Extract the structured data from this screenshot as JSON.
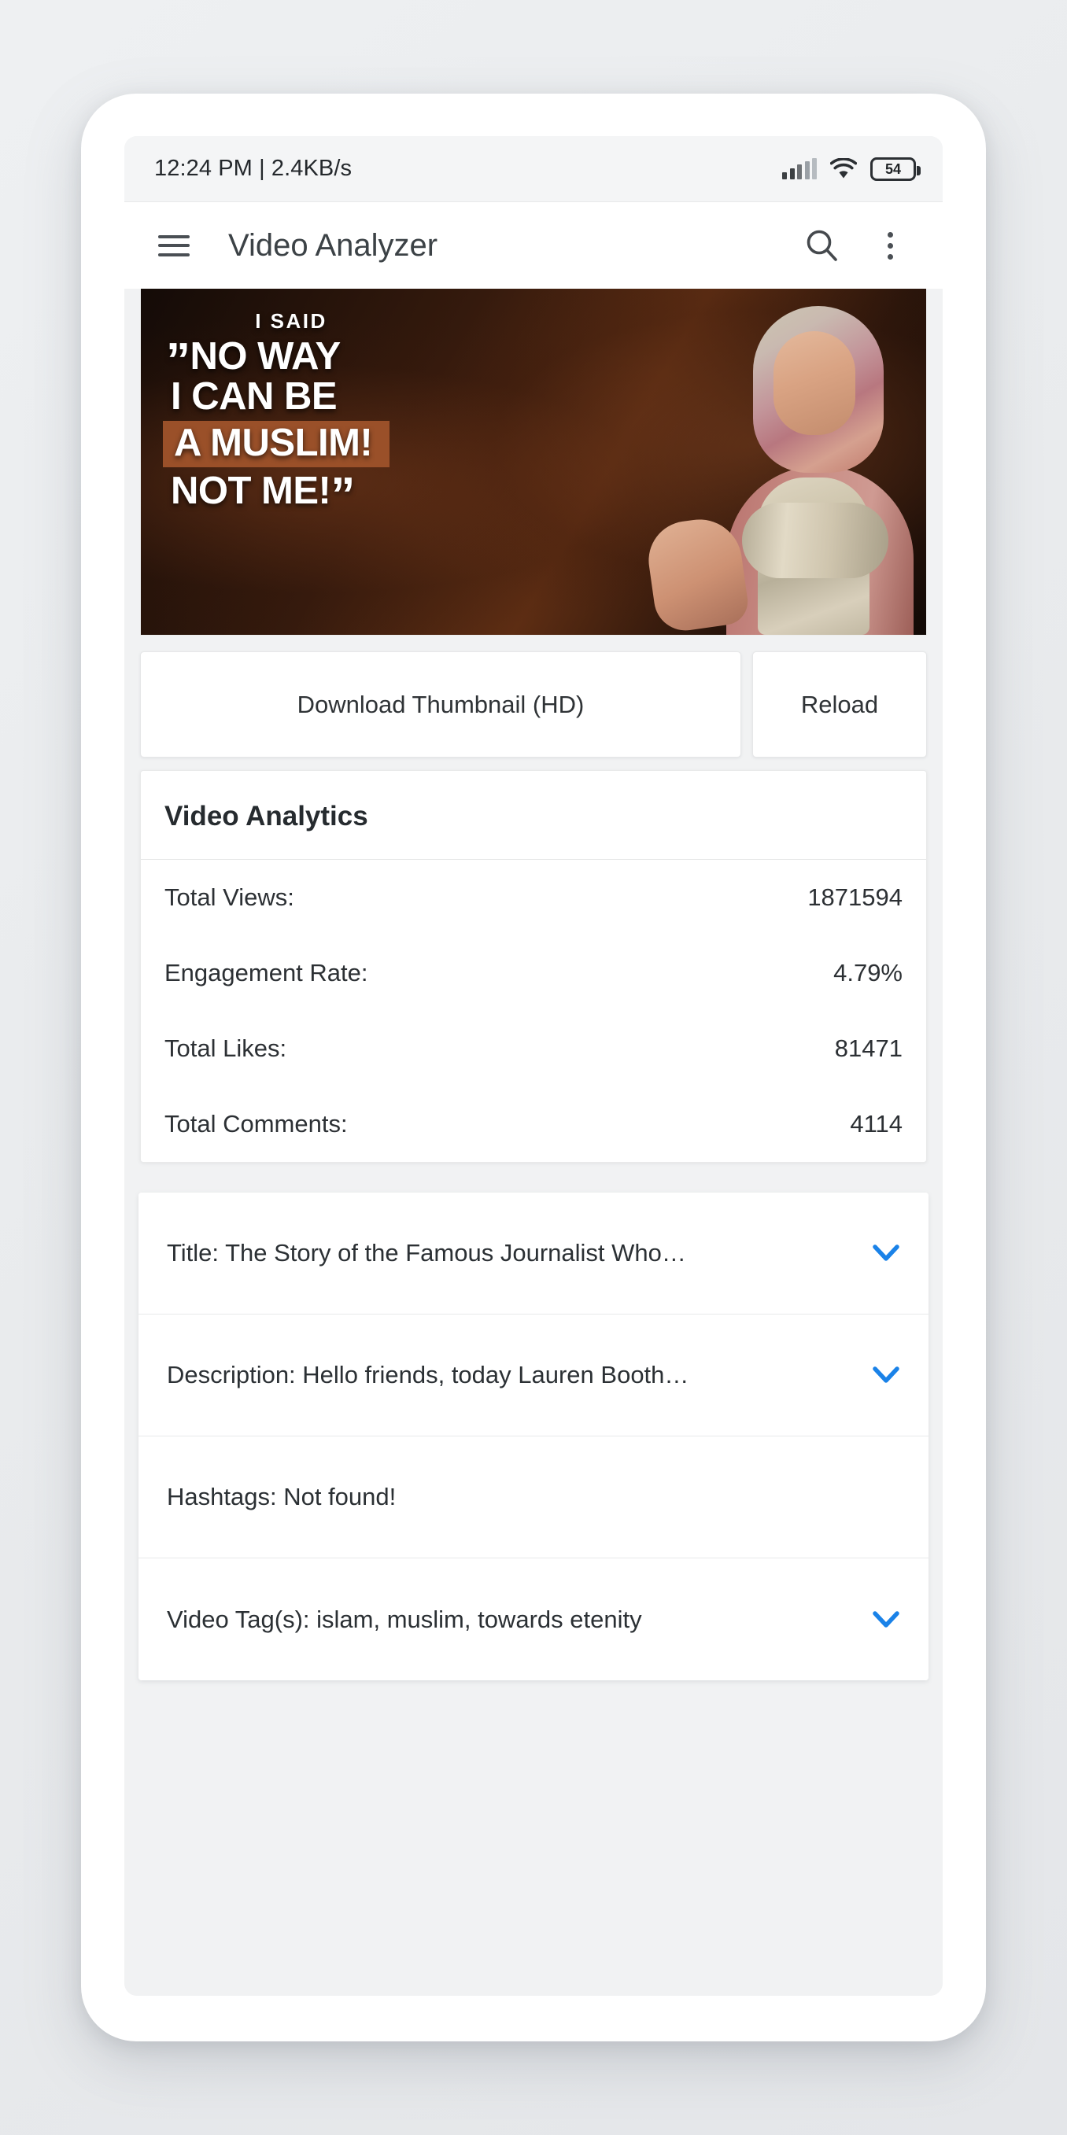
{
  "status_bar": {
    "time_and_speed": "12:24 PM | 2.4KB/s",
    "battery_level": "54",
    "icons": [
      "signal-bars-icon",
      "wifi-icon",
      "battery-icon"
    ]
  },
  "app_bar": {
    "title": "Video Analyzer",
    "menu_icon": "hamburger-menu-icon",
    "search_icon": "search-icon",
    "overflow_icon": "more-vertical-icon"
  },
  "thumbnail": {
    "alt": "video-thumbnail",
    "overlay_kicker": "I SAID",
    "overlay_line1": "NO WAY",
    "overlay_line2": "I CAN BE",
    "overlay_line3": "A MUSLIM!",
    "overlay_line4": "NOT ME!",
    "open_quote": "”",
    "close_quote": "”",
    "highlight_color": "#9a5029"
  },
  "actions": {
    "download_label": "Download Thumbnail (HD)",
    "reload_label": "Reload"
  },
  "analytics": {
    "section_title": "Video Analytics",
    "rows": [
      {
        "label": "Total Views:",
        "value": "1871594"
      },
      {
        "label": "Engagement Rate:",
        "value": "4.79%"
      },
      {
        "label": "Total Likes:",
        "value": "81471"
      },
      {
        "label": "Total Comments:",
        "value": "4114"
      }
    ]
  },
  "details": {
    "chevron_color": "#1a82e8",
    "rows": [
      {
        "label": "Title: The Story of the Famous Journalist Who…",
        "expandable": true
      },
      {
        "label": "Description: Hello friends, today Lauren Booth…",
        "expandable": true
      },
      {
        "label": "Hashtags: Not found!",
        "expandable": false
      },
      {
        "label": "Video Tag(s): islam, muslim, towards etenity",
        "expandable": true
      }
    ]
  }
}
